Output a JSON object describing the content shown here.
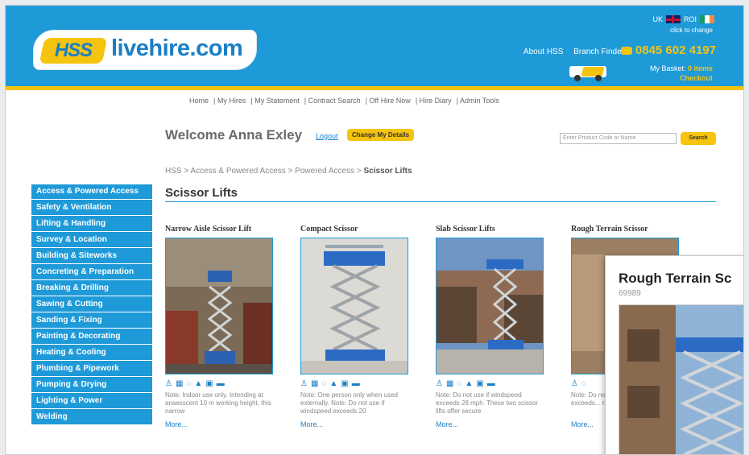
{
  "header": {
    "logo_badge": "HSS",
    "logo_text": "livehire.com",
    "region_uk": "UK",
    "region_roi": "ROI",
    "click_to_change": "click to change",
    "about": "About HSS",
    "branch_finder": "Branch Finder",
    "phone": "0845 602 4197",
    "basket_label": "My Basket:",
    "basket_count": "0 items",
    "checkout": "Checkout"
  },
  "topnav": [
    "Home",
    "My Hires",
    "My Statement",
    "Contract Search",
    "Off Hire Now",
    "Hire Diary",
    "Admin Tools"
  ],
  "welcome": {
    "text": "Welcome Anna Exley",
    "logout": "Logout",
    "change_details": "Change My Details"
  },
  "search": {
    "placeholder": "Enter Product Code or Name",
    "button": "Search"
  },
  "breadcrumb": {
    "path": "HSS > Access & Powered Access > Powered Access > ",
    "current": "Scissor Lifts"
  },
  "page_title": "Scissor Lifts",
  "sidebar": [
    "Access & Powered Access",
    "Safety & Ventilation",
    "Lifting & Handling",
    "Survey & Location",
    "Building & Siteworks",
    "Concreting & Preparation",
    "Breaking & Drilling",
    "Sawing & Cutting",
    "Sanding & Fixing",
    "Painting & Decorating",
    "Heating & Cooling",
    "Plumbing & Pipework",
    "Pumping & Drying",
    "Lighting & Power",
    "Welding"
  ],
  "products": [
    {
      "title": "Narrow Aisle Scissor Lift",
      "note": "Note: Indoor use only. Intending at anaesscent 10 m working height, this narrow",
      "more": "More..."
    },
    {
      "title": "Compact Scissor",
      "note": "Note: One person only when used externally. Note: Do not use if windspeed exceeds 20",
      "more": "More..."
    },
    {
      "title": "Slab Scissor Lifts",
      "note": "Note: Do not use if windspeed exceeds 28 mph. These two scissor lifts offer secure",
      "more": "More..."
    },
    {
      "title": "Rough Terrain Scissor",
      "note": "Note: Do not use if windspeed exceeds... not suit...",
      "more": "More..."
    }
  ],
  "popup": {
    "title": "Rough Terrain Sc",
    "code": "69989"
  },
  "colors": {
    "brand_blue": "#1f9ad8",
    "brand_yellow": "#f5c40f"
  }
}
